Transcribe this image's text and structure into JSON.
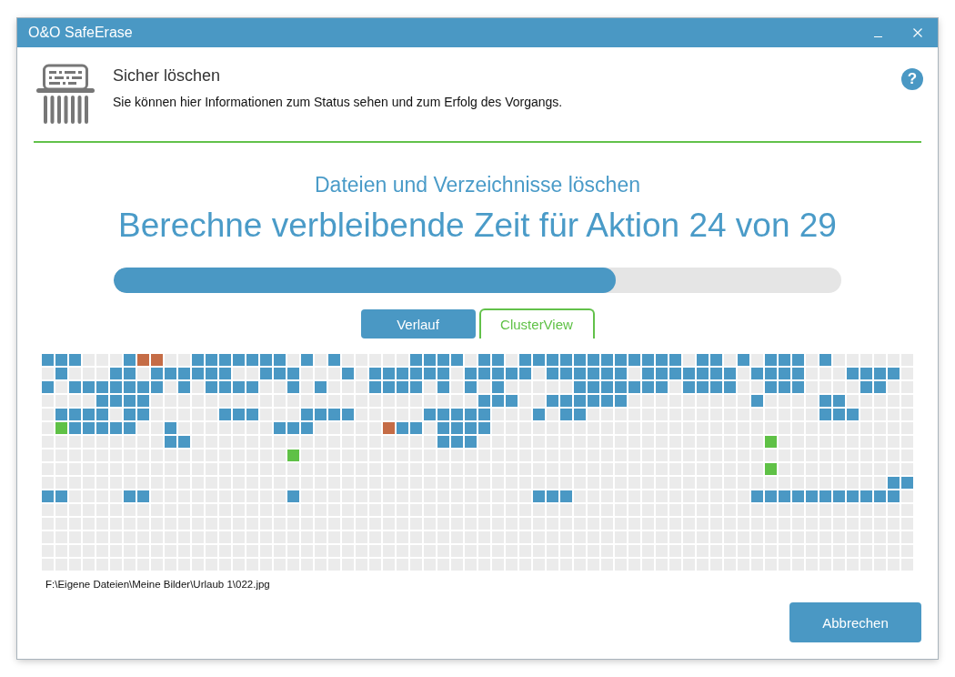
{
  "window": {
    "title": "O&O SafeErase"
  },
  "header": {
    "title": "Sicher löschen",
    "description": "Sie können hier Informationen zum Status sehen und zum Erfolg des Vorgangs.",
    "help_button": "?"
  },
  "progress": {
    "subtitle": "Dateien und Verzeichnisse löschen",
    "status": "Berechne verbleibende Zeit für Aktion 24 von 29",
    "level": 0.69
  },
  "tabs": [
    {
      "label": "Verlauf",
      "selected": false
    },
    {
      "label": "ClusterView",
      "selected": true
    }
  ],
  "current_file": "F:\\Eigene Dateien\\Meine Bilder\\Urlaub 1\\022.jpg",
  "cancel_button": "Abbrechen"
}
